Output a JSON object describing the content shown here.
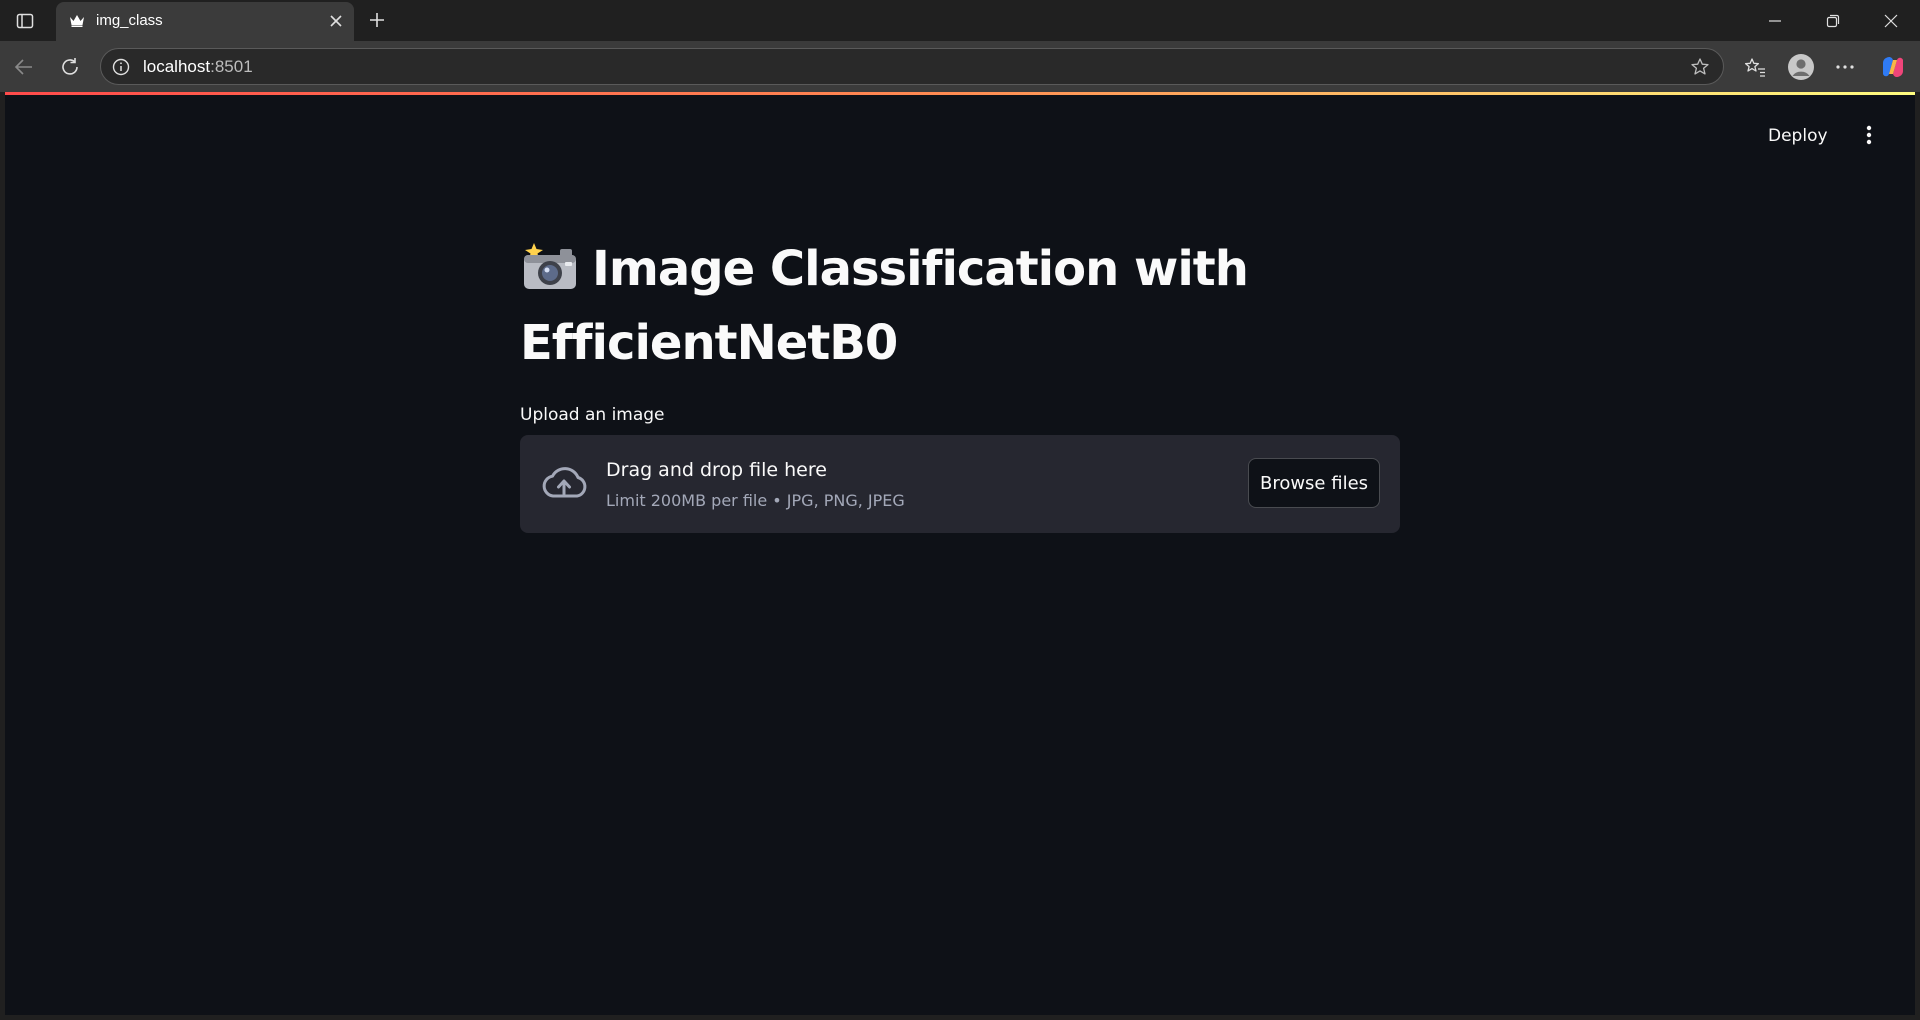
{
  "browser": {
    "tab_title": "img_class",
    "url_host": "localhost",
    "url_port": ":8501",
    "icons": {
      "sidebar": "sidebar-toggle-icon",
      "favicon": "streamlit-crown-icon",
      "close_tab": "close-icon",
      "new_tab": "plus-icon",
      "back": "back-arrow-icon",
      "reload": "reload-icon",
      "site_info": "info-icon",
      "favorite": "star-icon",
      "favorites": "favorites-icon",
      "profile": "profile-icon",
      "more": "more-horizontal-icon",
      "copilot": "copilot-icon",
      "minimize": "minimize-icon",
      "restore": "restore-icon",
      "close_window": "close-window-icon"
    }
  },
  "app": {
    "deploy_label": "Deploy",
    "title_emoji": "camera-with-flash-icon",
    "title": "Image Classification with EfficientNetB0",
    "uploader": {
      "label": "Upload an image",
      "drop_text": "Drag and drop file here",
      "limit_text": "Limit 200MB per file • JPG, PNG, JPEG",
      "browse_label": "Browse files"
    }
  },
  "colors": {
    "app_background": "#0e1117",
    "dropzone_background": "#262730",
    "text_primary": "#fafafa",
    "text_secondary": "#a3a8b8",
    "accent_red": "#ff4b4b",
    "accent_yellow": "#fffd80"
  }
}
